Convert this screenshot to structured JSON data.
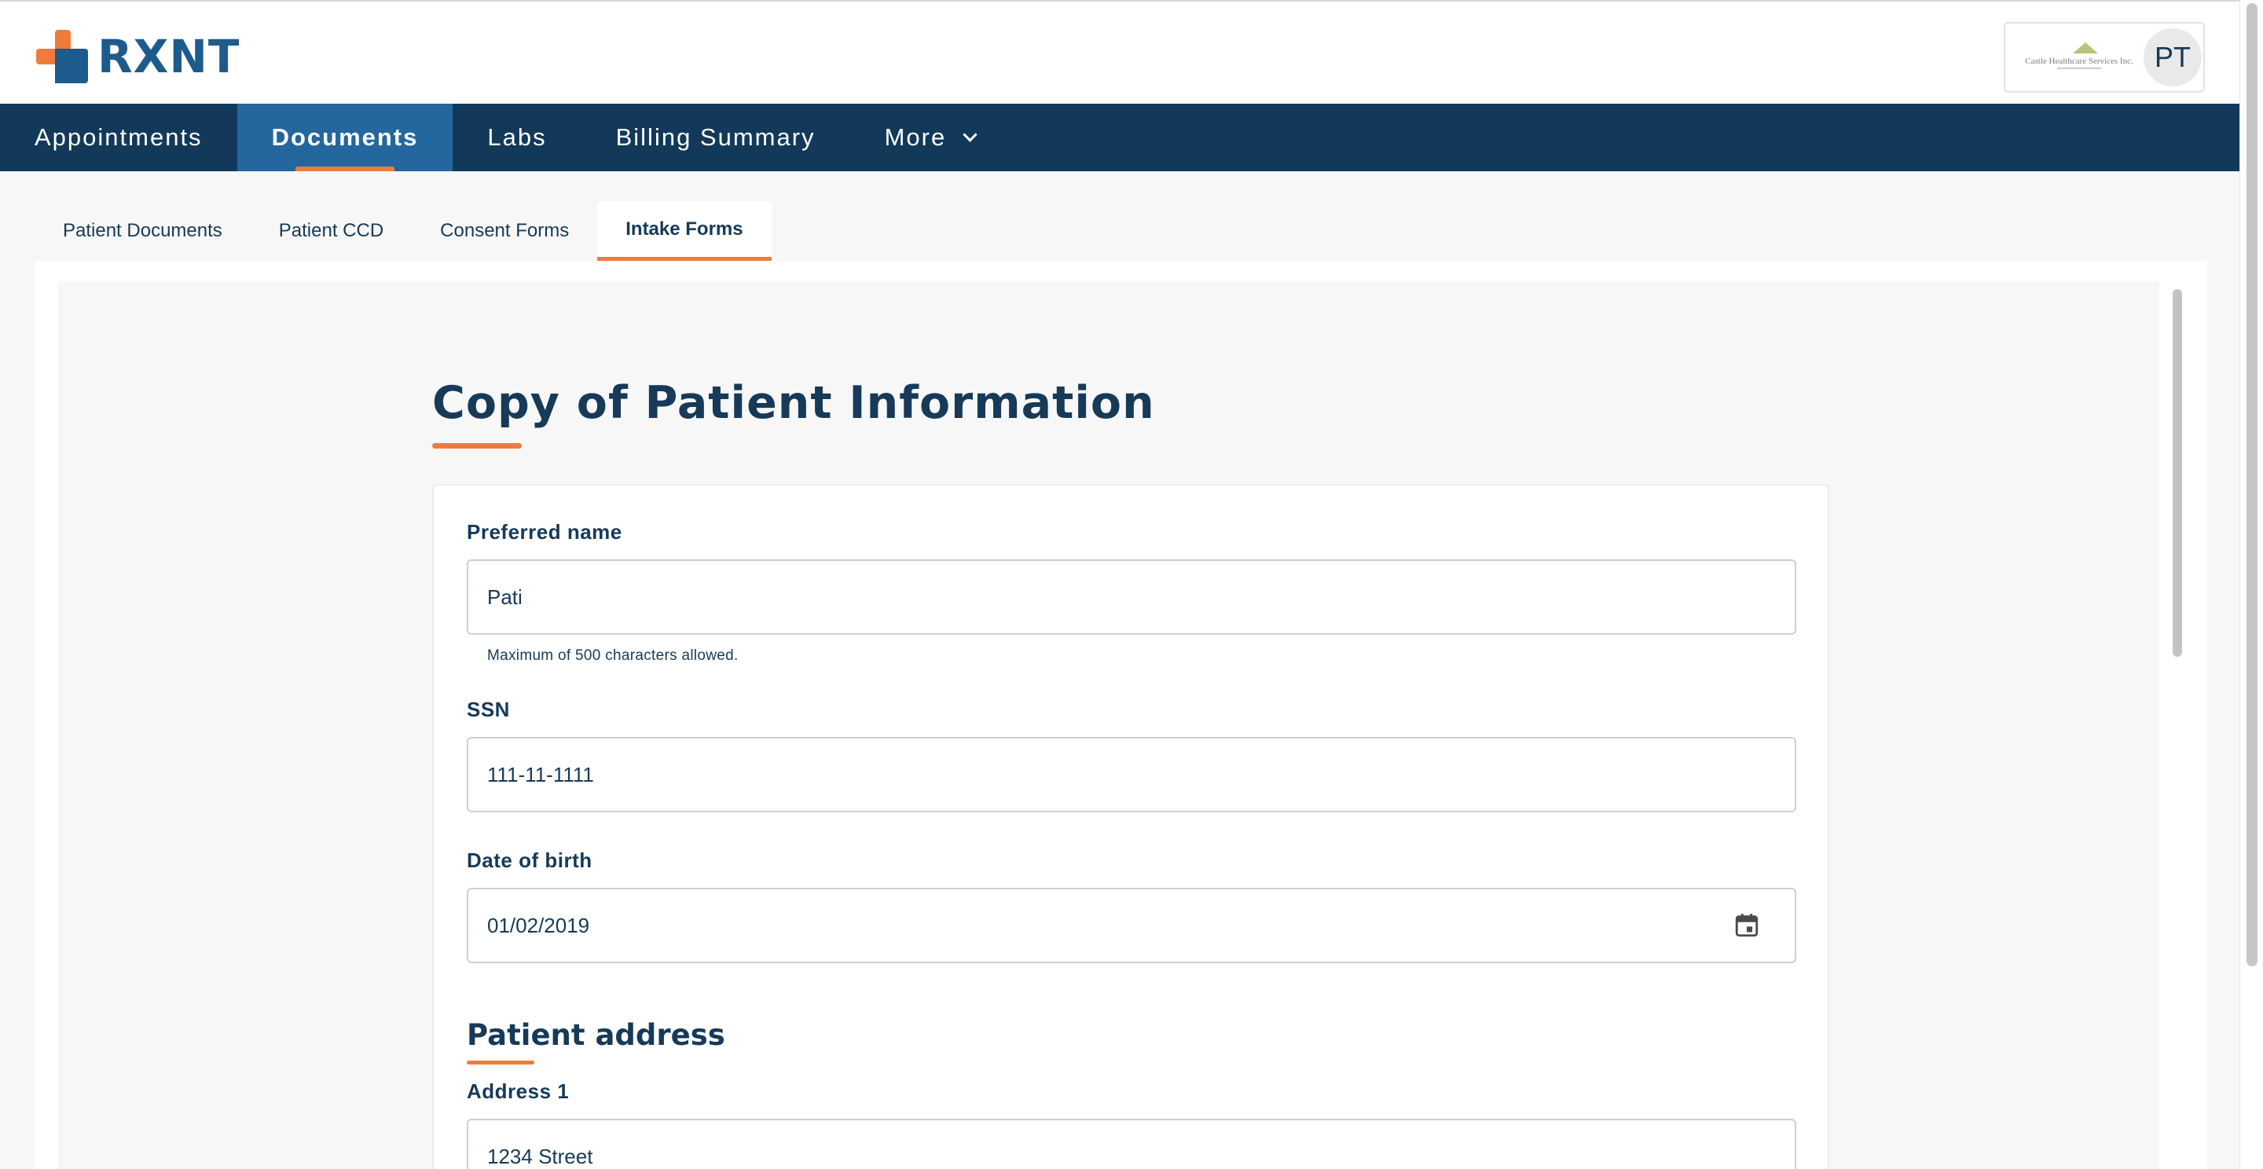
{
  "brand": {
    "name": "RXNT"
  },
  "org": {
    "name": "Castle Healthcare Services Inc."
  },
  "user": {
    "initials": "PT"
  },
  "nav": {
    "items": [
      {
        "label": "Appointments"
      },
      {
        "label": "Documents"
      },
      {
        "label": "Labs"
      },
      {
        "label": "Billing Summary"
      },
      {
        "label": "More"
      }
    ],
    "active": "Documents"
  },
  "subtabs": {
    "items": [
      {
        "label": "Patient Documents"
      },
      {
        "label": "Patient CCD"
      },
      {
        "label": "Consent Forms"
      },
      {
        "label": "Intake Forms"
      }
    ],
    "active": "Intake Forms"
  },
  "form": {
    "title": "Copy of Patient Information",
    "preferred_name": {
      "label": "Preferred name",
      "value": "Pati",
      "hint": "Maximum of 500 characters allowed."
    },
    "ssn": {
      "label": "SSN",
      "value": "111-11-1111"
    },
    "dob": {
      "label": "Date of birth",
      "value": "01/02/2019"
    },
    "address_section": {
      "heading": "Patient address"
    },
    "address1": {
      "label": "Address 1",
      "value": "1234 Street"
    }
  },
  "colors": {
    "nav_bg": "#13395a",
    "nav_active": "#23679e",
    "accent": "#ef7b3b",
    "text": "#163a58"
  },
  "icons": [
    "calendar-icon",
    "chevron-down-icon"
  ]
}
